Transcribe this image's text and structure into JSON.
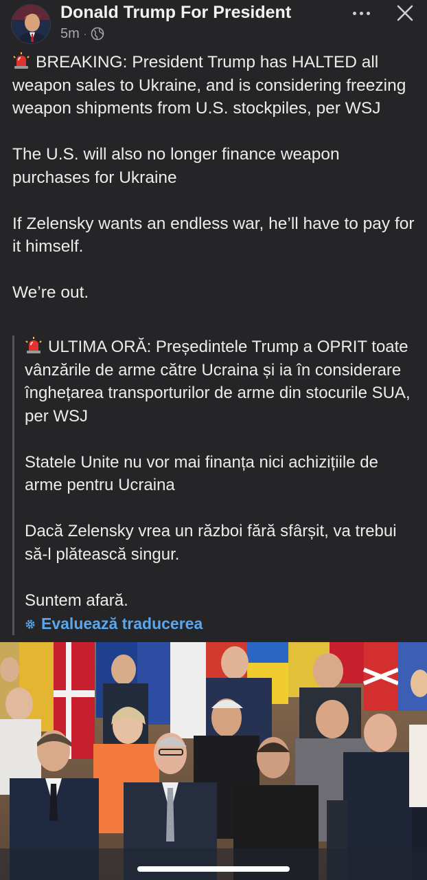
{
  "header": {
    "page_name": "Donald Trump For President",
    "time": "5m",
    "separator": "·",
    "audience_icon": "globe-icon",
    "more_icon": "ellipsis-icon",
    "close_icon": "close-icon"
  },
  "post": {
    "paragraphs": [
      "BREAKING: President Trump has HALTED all weapon sales to Ukraine, and is considering freezing weapon shipments from U.S. stockpiles, per WSJ",
      "The U.S. will also no longer finance weapon purchases for Ukraine",
      "If Zelensky wants an endless war, he’ll have to pay for it himself.",
      "We’re out."
    ],
    "lead_icon": "siren-icon"
  },
  "translation": {
    "paragraphs": [
      "ULTIMA ORĂ: Președintele Trump a OPRIT toate vânzările de arme către Ucraina și ia în considerare înghețarea transporturilor de arme din stocurile SUA, per WSJ",
      "Statele Unite nu vor mai finanța nici achizițiile de arme pentru Ucraina",
      "Dacă Zelensky vrea un război fără sfârșit, va trebui să-l plătească singur.",
      "Suntem afară."
    ],
    "rate_label": "Evaluează traducerea",
    "rate_icon": "gear-icon",
    "accent_color": "#5AA7F0"
  },
  "photo": {
    "description_icon": "group-photo-image"
  },
  "colors": {
    "background": "#252527",
    "text": "#ECECEC",
    "secondary_text": "#A9A9AD",
    "link": "#5AA7F0"
  }
}
